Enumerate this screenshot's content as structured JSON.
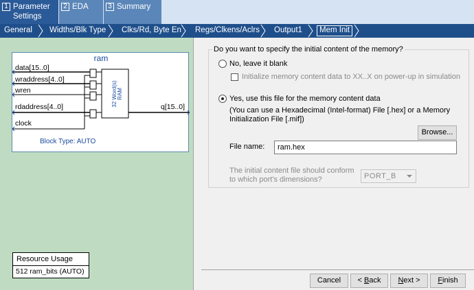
{
  "steps": [
    {
      "num": "1",
      "label_l1": "Parameter",
      "label_l2": "Settings"
    },
    {
      "num": "2",
      "label": "EDA"
    },
    {
      "num": "3",
      "label": "Summary"
    }
  ],
  "breadcrumbs": [
    "General",
    "Widths/Blk Type",
    "Clks/Rd, Byte En",
    "Regs/Clkens/Aclrs",
    "Output1",
    "Mem Init"
  ],
  "diagram": {
    "title": "ram",
    "inputs": [
      "data[15..0]",
      "wraddress[4..0]",
      "wren",
      "rdaddress[4..0]",
      "clock"
    ],
    "output": "q[15..0]",
    "block_text_l1": "32 Word(s)",
    "block_text_l2": "RAM",
    "block_type": "Block Type: AUTO"
  },
  "resource": {
    "header": "Resource Usage",
    "value": "512 ram_bits (AUTO)"
  },
  "form": {
    "group_title": "Do you want to specify the initial content of the memory?",
    "option_no": "No, leave it blank",
    "init_check": "Initialize memory content data to XX..X on power-up in simulation",
    "option_yes": "Yes, use this file for the memory content data",
    "hint_l1": "(You can use a Hexadecimal (Intel-format) File [.hex] or a Memory",
    "hint_l2": "Initialization File [.mif])",
    "browse": "Browse...",
    "file_label": "File name:",
    "file_value": "ram.hex",
    "conform_l1": "The initial content file should conform",
    "conform_l2": "to which port's dimensions?",
    "port_value": "PORT_B",
    "selected": "yes"
  },
  "buttons": {
    "cancel": "Cancel",
    "back": "< Back",
    "next": "Next >",
    "finish": "Finish"
  }
}
